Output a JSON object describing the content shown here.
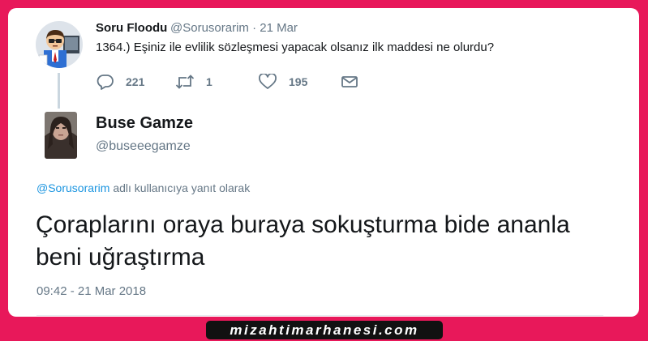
{
  "quoted_tweet": {
    "author_name": "Soru Floodu",
    "meta": "@Sorusorarim · 21 Mar",
    "text": "1364.) Eşiniz ile evlilik sözleşmesi yapacak olsanız ilk maddesi ne olurdu?",
    "actions": {
      "reply_count": "221",
      "retweet_count": "1",
      "like_count": "195"
    },
    "icons": [
      "reply-icon",
      "retweet-icon",
      "heart-icon",
      "envelope-icon"
    ]
  },
  "reply_tweet": {
    "author_name": "Buse Gamze",
    "handle": "@buseeegamze",
    "replying_mention": "@Sorusorarim",
    "replying_suffix": " adlı kullanıcıya yanıt olarak",
    "text": "Çoraplarını oraya buraya sokuşturma bide ananla beni uğraştırma",
    "timestamp": "09:42 - 21 Mar 2018"
  },
  "watermark": "mizahtimarhanesi.com",
  "colors": {
    "frame": "#e8185a",
    "card": "#ffffff",
    "text": "#14171a",
    "muted": "#657786",
    "link": "#1b95e0",
    "watermark_bg": "#111111"
  }
}
